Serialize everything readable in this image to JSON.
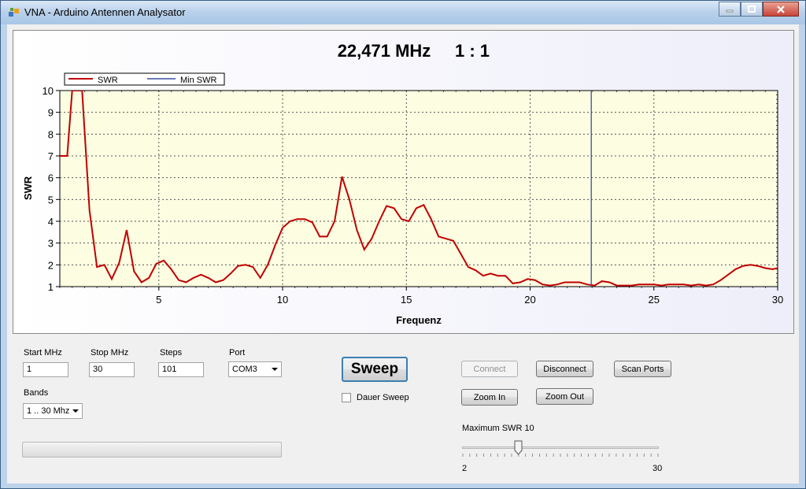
{
  "window": {
    "title": "VNA - Arduino Antennen Analysator"
  },
  "chart": {
    "readout_freq": "22,471 MHz",
    "readout_ratio": "1 : 1",
    "xlabel": "Frequenz",
    "ylabel": "SWR",
    "legend": [
      "SWR",
      "Min SWR"
    ]
  },
  "chart_data": {
    "type": "line",
    "title": "22,471 MHz   1 : 1",
    "xlabel": "Frequenz",
    "ylabel": "SWR",
    "xlim": [
      1,
      30
    ],
    "ylim": [
      1,
      10
    ],
    "x_ticks": [
      5,
      10,
      15,
      20,
      25,
      30
    ],
    "y_ticks": [
      1,
      2,
      3,
      4,
      5,
      6,
      7,
      8,
      9,
      10
    ],
    "grid": true,
    "legend_position": "top-left",
    "series": [
      {
        "name": "SWR",
        "color": "#c00000",
        "x": [
          1.0,
          1.3,
          1.5,
          1.9,
          2.2,
          2.5,
          2.8,
          3.1,
          3.4,
          3.7,
          4.0,
          4.3,
          4.6,
          4.9,
          5.2,
          5.5,
          5.8,
          6.1,
          6.4,
          6.7,
          7.0,
          7.3,
          7.6,
          7.9,
          8.2,
          8.5,
          8.8,
          9.1,
          9.4,
          9.7,
          10.0,
          10.3,
          10.6,
          10.9,
          11.2,
          11.5,
          11.8,
          12.1,
          12.4,
          12.7,
          13.0,
          13.3,
          13.6,
          13.9,
          14.2,
          14.5,
          14.8,
          15.1,
          15.4,
          15.7,
          16.0,
          16.3,
          16.6,
          16.9,
          17.2,
          17.5,
          17.8,
          18.1,
          18.4,
          18.7,
          19.0,
          19.3,
          19.6,
          19.9,
          20.2,
          20.5,
          20.8,
          21.1,
          21.4,
          21.7,
          22.0,
          22.3,
          22.6,
          22.9,
          23.2,
          23.5,
          23.8,
          24.1,
          24.4,
          24.7,
          25.0,
          25.3,
          25.6,
          25.9,
          26.2,
          26.5,
          26.8,
          27.1,
          27.4,
          27.7,
          28.0,
          28.3,
          28.6,
          28.9,
          29.2,
          29.5,
          29.8,
          30.0
        ],
        "values": [
          7.0,
          7.0,
          10.0,
          10.0,
          4.5,
          1.9,
          2.0,
          1.35,
          2.1,
          3.6,
          1.7,
          1.2,
          1.4,
          2.05,
          2.2,
          1.8,
          1.3,
          1.2,
          1.4,
          1.55,
          1.4,
          1.2,
          1.3,
          1.6,
          1.95,
          2.0,
          1.9,
          1.4,
          2.0,
          2.9,
          3.7,
          4.0,
          4.1,
          4.1,
          3.95,
          3.3,
          3.3,
          4.0,
          6.05,
          5.0,
          3.6,
          2.7,
          3.2,
          4.0,
          4.7,
          4.6,
          4.1,
          4.0,
          4.6,
          4.75,
          4.1,
          3.3,
          3.2,
          3.1,
          2.5,
          1.9,
          1.75,
          1.5,
          1.6,
          1.5,
          1.5,
          1.15,
          1.2,
          1.35,
          1.3,
          1.1,
          1.05,
          1.1,
          1.2,
          1.2,
          1.2,
          1.1,
          1.05,
          1.25,
          1.2,
          1.05,
          1.05,
          1.05,
          1.1,
          1.1,
          1.1,
          1.05,
          1.1,
          1.1,
          1.1,
          1.05,
          1.1,
          1.05,
          1.1,
          1.3,
          1.55,
          1.8,
          1.95,
          2.0,
          1.95,
          1.85,
          1.8,
          1.85
        ]
      },
      {
        "name": "Min SWR",
        "color": "#3a4fa0",
        "x": [
          22.471,
          22.471
        ],
        "values": [
          1,
          10
        ]
      }
    ]
  },
  "controls": {
    "start_label": "Start MHz",
    "start_value": "1",
    "stop_label": "Stop MHz",
    "stop_value": "30",
    "steps_label": "Steps",
    "steps_value": "101",
    "port_label": "Port",
    "port_value": "COM3",
    "bands_label": "Bands",
    "bands_value": "1 .. 30 Mhz",
    "sweep_label": "Sweep",
    "dauer_label": "Dauer Sweep",
    "connect_label": "Connect",
    "disconnect_label": "Disconnect",
    "scan_label": "Scan Ports",
    "zoom_in_label": "Zoom In",
    "zoom_out_label": "Zoom Out",
    "max_swr_label": "Maximum SWR  10",
    "slider_min": "2",
    "slider_max": "30",
    "slider_value": 10,
    "progress": 0
  }
}
